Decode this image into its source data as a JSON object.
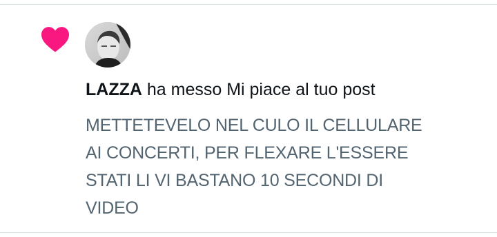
{
  "notification": {
    "type_icon": "heart-icon",
    "icon_color": "#f91880",
    "avatar_alt": "profile photo",
    "user_name": "LAZZA",
    "action_text": "ha messo Mi piace al tuo post",
    "post_lines": [
      "METTETEVELO NEL CULO IL CELLULARE",
      "AI CONCERTI, PER FLEXARE L'ESSERE",
      "STATI LI VI BASTANO 10 SECONDI DI",
      "VIDEO"
    ]
  },
  "colors": {
    "primary_text": "#0f1419",
    "secondary_text": "#536471",
    "divider": "#dfe6e9",
    "like": "#f91880"
  }
}
